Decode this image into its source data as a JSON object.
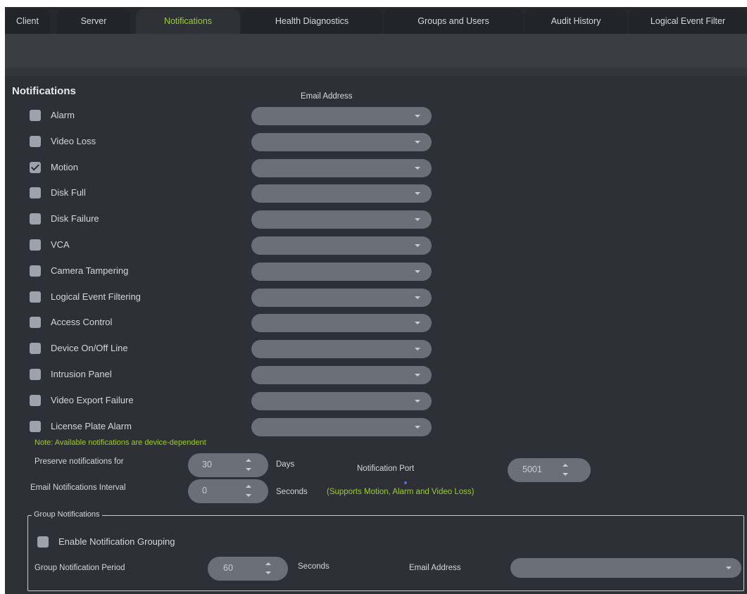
{
  "tabs": [
    {
      "label": "Client",
      "active": false
    },
    {
      "label": "Server",
      "active": false
    },
    {
      "label": "Notifications",
      "active": true
    },
    {
      "label": "Health Diagnostics",
      "active": false
    },
    {
      "label": "Groups and Users",
      "active": false
    },
    {
      "label": "Audit History",
      "active": false
    },
    {
      "label": "Logical Event Filter",
      "active": false
    }
  ],
  "section_title": "Notifications",
  "email_address_header": "Email Address",
  "notifications": [
    {
      "label": "Alarm",
      "checked": false,
      "email": ""
    },
    {
      "label": "Video Loss",
      "checked": false,
      "email": ""
    },
    {
      "label": "Motion",
      "checked": true,
      "email": ""
    },
    {
      "label": "Disk Full",
      "checked": false,
      "email": ""
    },
    {
      "label": "Disk Failure",
      "checked": false,
      "email": ""
    },
    {
      "label": "VCA",
      "checked": false,
      "email": ""
    },
    {
      "label": "Camera Tampering",
      "checked": false,
      "email": ""
    },
    {
      "label": "Logical Event Filtering",
      "checked": false,
      "email": ""
    },
    {
      "label": "Access Control",
      "checked": false,
      "email": ""
    },
    {
      "label": "Device On/Off Line",
      "checked": false,
      "email": ""
    },
    {
      "label": "Intrusion Panel",
      "checked": false,
      "email": ""
    },
    {
      "label": "Video Export Failure",
      "checked": false,
      "email": ""
    },
    {
      "label": "License Plate Alarm",
      "checked": false,
      "email": ""
    }
  ],
  "note": "Note: Available notifications are device-dependent",
  "preserve": {
    "label": "Preserve notifications for",
    "value": "30",
    "unit": "Days"
  },
  "interval": {
    "label": "Email Notifications Interval",
    "value": "0",
    "unit": "Seconds",
    "hint": "(Supports Motion, Alarm and Video Loss)"
  },
  "port": {
    "label": "Notification Port",
    "value": "5001"
  },
  "group": {
    "legend": "Group Notifications",
    "enable_label": "Enable Notification Grouping",
    "enable_checked": false,
    "period_label": "Group Notification Period",
    "period_value": "60",
    "period_unit": "Seconds",
    "email_label": "Email Address",
    "email_value": ""
  },
  "colors": {
    "accent": "#9ccc2b",
    "background": "#2d3035",
    "control": "#6b7077"
  },
  "icons": {
    "checkbox": "checkbox-icon",
    "dropdown": "chevron-down-icon",
    "spinner_up": "spinner-up-icon",
    "spinner_down": "spinner-down-icon"
  }
}
